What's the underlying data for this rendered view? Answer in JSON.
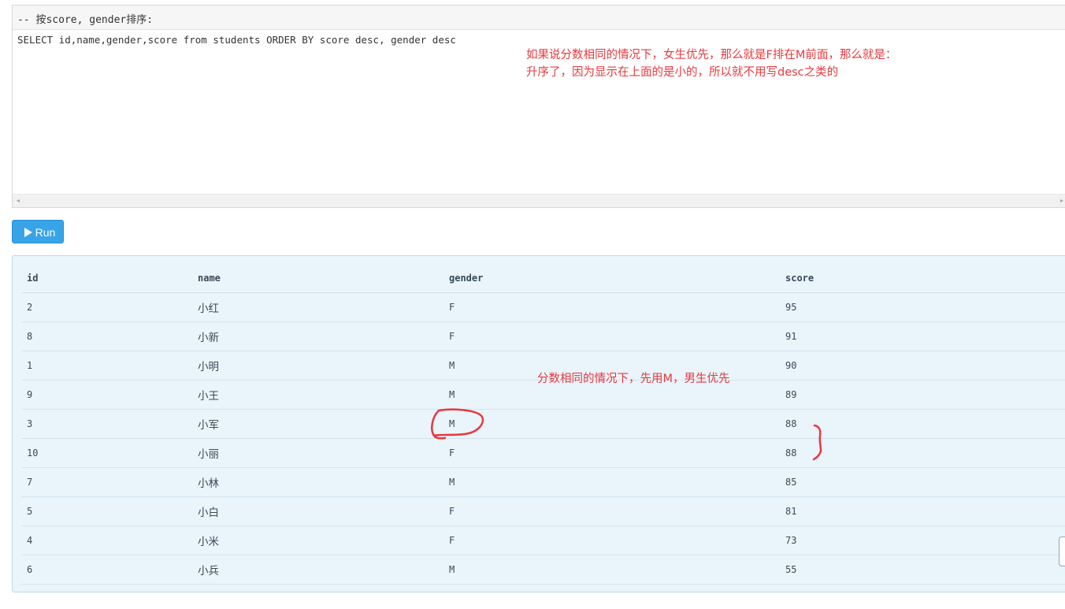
{
  "editor": {
    "comment": "-- 按score, gender排序:",
    "code": "SELECT id,name,gender,score from students ORDER BY score desc, gender desc",
    "scroll_left_icon": "◂",
    "scroll_right_icon": "▸"
  },
  "annotations": {
    "top_line1": "如果说分数相同的情况下，女生优先，那么就是F排在M前面，那么就是：",
    "top_line2": "升序了，因为显示在上面的是小的，所以就不用写desc之类的",
    "middle": "分数相同的情况下，先用M，男生优先",
    "color": "#e8383d"
  },
  "run_button": {
    "label": "Run",
    "icon": "play-icon",
    "color": "#38a4e8"
  },
  "result": {
    "headers": [
      "id",
      "name",
      "gender",
      "score"
    ],
    "rows": [
      [
        "2",
        "小红",
        "F",
        "95"
      ],
      [
        "8",
        "小新",
        "F",
        "91"
      ],
      [
        "1",
        "小明",
        "M",
        "90"
      ],
      [
        "9",
        "小王",
        "M",
        "89"
      ],
      [
        "3",
        "小军",
        "M",
        "88"
      ],
      [
        "10",
        "小丽",
        "F",
        "88"
      ],
      [
        "7",
        "小林",
        "M",
        "85"
      ],
      [
        "5",
        "小白",
        "F",
        "81"
      ],
      [
        "4",
        "小米",
        "F",
        "73"
      ],
      [
        "6",
        "小兵",
        "M",
        "55"
      ]
    ]
  }
}
